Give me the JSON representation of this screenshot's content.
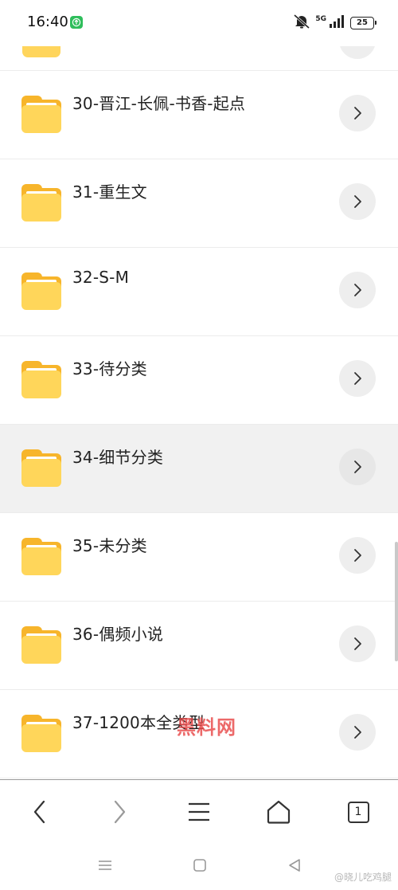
{
  "status_bar": {
    "time": "16:40",
    "network": "5G",
    "battery": "25",
    "icons": [
      "app-notification-icon",
      "mute-icon",
      "signal-icon",
      "battery-icon"
    ]
  },
  "files": [
    {
      "name": "30-晋江-长佩-书香-起点"
    },
    {
      "name": "31-重生文"
    },
    {
      "name": "32-S-M"
    },
    {
      "name": "33-待分类"
    },
    {
      "name": "34-细节分类",
      "selected": true
    },
    {
      "name": "35-未分类"
    },
    {
      "name": "36-偶频小说"
    },
    {
      "name": "37-1200本全类型"
    }
  ],
  "watermark": "黑料网",
  "toolbar": {
    "tab_count": "1",
    "icons": [
      "back-icon",
      "forward-icon",
      "menu-icon",
      "home-icon",
      "tabs-icon"
    ]
  },
  "system_nav": {
    "credit": "@晓儿吃鸡腿",
    "icons": [
      "recents-icon",
      "home-icon",
      "back-icon"
    ]
  },
  "colors": {
    "folder_body": "#ffd65a",
    "folder_back": "#f7b52b",
    "arrow_bg": "#eeeeee",
    "selected_row": "#f1f1f1",
    "app_badge": "#2fbe5b"
  }
}
